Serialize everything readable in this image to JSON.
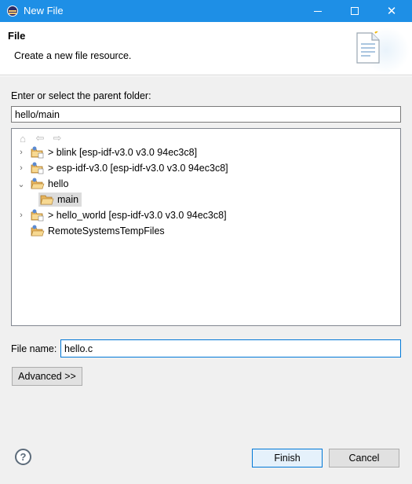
{
  "window": {
    "title": "New File",
    "minimize_glyph": "—",
    "maximize_glyph": "☐",
    "close_glyph": "✕"
  },
  "header": {
    "title": "File",
    "description": "Create a new file resource."
  },
  "parent_folder": {
    "label": "Enter or select the parent folder:",
    "value": "hello/main"
  },
  "tree": {
    "toolbar": [
      {
        "name": "home-icon",
        "glyph": "⌂"
      },
      {
        "name": "back-icon",
        "glyph": "⇦"
      },
      {
        "name": "forward-icon",
        "glyph": "⇨"
      }
    ],
    "items": [
      {
        "label": "> blink  [esp-idf-v3.0 v3.0 94ec3c8]",
        "expanded": false,
        "level": 0,
        "type": "git-project"
      },
      {
        "label": "> esp-idf-v3.0  [esp-idf-v3.0 v3.0 94ec3c8]",
        "expanded": false,
        "level": 0,
        "type": "git-project"
      },
      {
        "label": "hello",
        "expanded": true,
        "level": 0,
        "type": "project"
      },
      {
        "label": "main",
        "expanded": false,
        "level": 1,
        "type": "folder",
        "selected": true
      },
      {
        "label": "> hello_world  [esp-idf-v3.0 v3.0 94ec3c8]",
        "expanded": false,
        "level": 0,
        "type": "git-project"
      },
      {
        "label": "RemoteSystemsTempFiles",
        "expanded": false,
        "level": 0,
        "type": "project"
      }
    ]
  },
  "file_name": {
    "label": "File name:",
    "value": "hello.c"
  },
  "buttons": {
    "advanced": "Advanced >>",
    "finish": "Finish",
    "cancel": "Cancel",
    "help": "?"
  },
  "colors": {
    "titlebar": "#1e8fe6",
    "focus_border": "#0078d7",
    "dialog_bg": "#f0f0f0",
    "selection": "#dcdcdc"
  }
}
